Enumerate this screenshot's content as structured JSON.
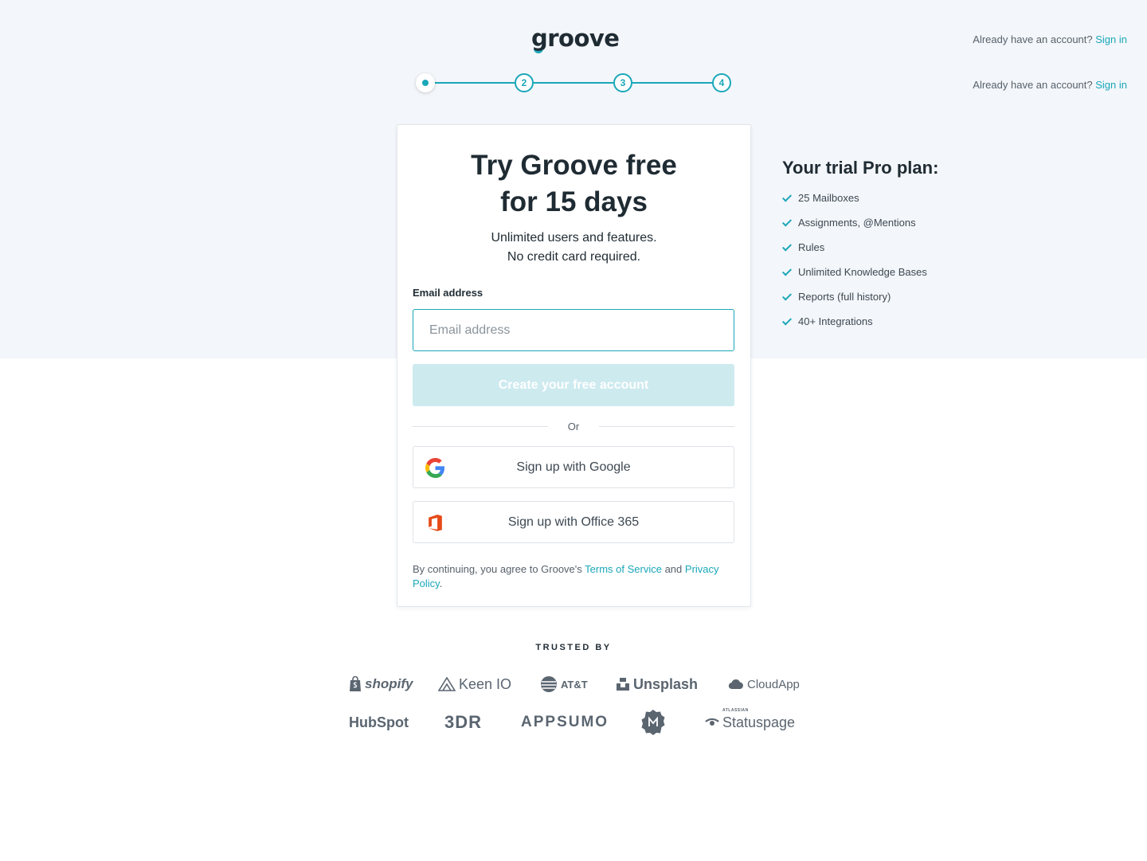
{
  "header": {
    "logo_text": "groove",
    "signin_prompt": "Already have an account?",
    "signin_link": "Sign in",
    "signin_prompt_2": "Already have an account?",
    "signin_link_2": "Sign in"
  },
  "stepper": {
    "current_step": 1,
    "steps": [
      "1",
      "2",
      "3",
      "4"
    ]
  },
  "card": {
    "title_line1": "Try Groove free",
    "title_line2": "for 15 days",
    "subtitle_line1": "Unlimited users and features.",
    "subtitle_line2": "No credit card required.",
    "email_label": "Email address",
    "email_placeholder": "Email address",
    "email_value": "",
    "create_button": "Create your free account",
    "or_text": "Or",
    "google_button": "Sign up with Google",
    "office_button": "Sign up with Office 365",
    "legal_prefix": "By continuing, you agree to Groove's ",
    "terms_link": "Terms of Service",
    "legal_and": " and",
    "privacy_link": "Privacy Policy",
    "legal_suffix": "."
  },
  "plan": {
    "title": "Your trial Pro plan:",
    "features": [
      "25 Mailboxes",
      "Assignments, @Mentions",
      "Rules",
      "Unlimited Knowledge Bases",
      "Reports (full history)",
      "40+ Integrations"
    ]
  },
  "trusted": {
    "label": "TRUSTED BY",
    "row1": [
      "shopify",
      "Keen IO",
      "AT&T",
      "Unsplash",
      "CloudApp"
    ],
    "row2": [
      "HubSpot",
      "3DR",
      "APPSUMO",
      "",
      "Statuspage"
    ],
    "statuspage_small": "ATLASSIAN"
  },
  "colors": {
    "accent": "#1aa7b9",
    "hero_background": "#f3f6fa",
    "disabled_button": "#cdeaef",
    "logo_gray": "#5a6570"
  }
}
